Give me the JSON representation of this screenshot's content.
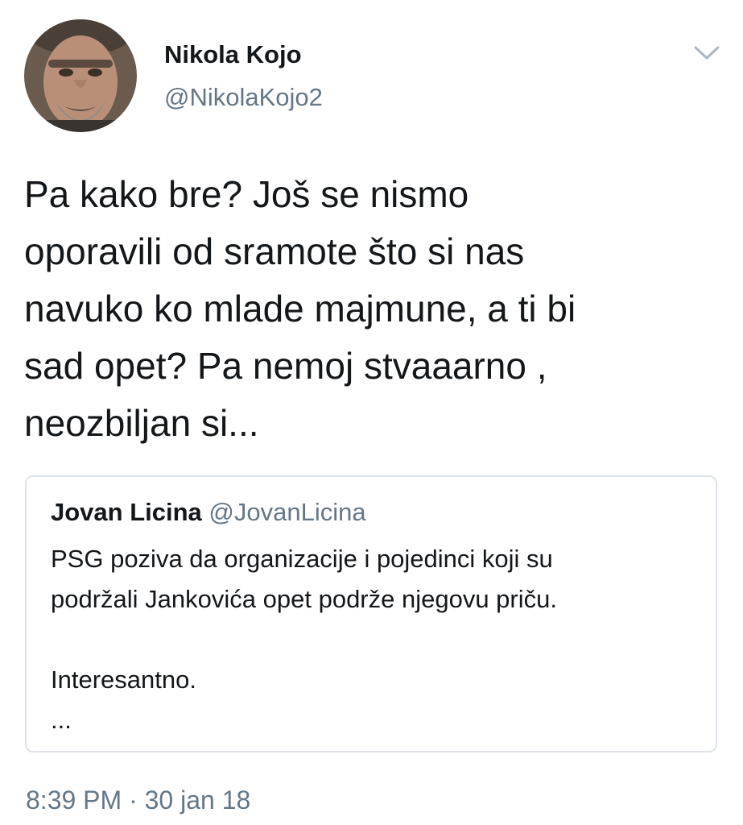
{
  "author": {
    "name": "Nikola Kojo",
    "handle": "@NikolaKojo2",
    "avatar_icon": "profile-photo"
  },
  "menu_icon": "chevron-down-icon",
  "tweet": {
    "lines": [
      "Pa kako bre? Još se nismo",
      "oporavili od sramote što si nas",
      "navuko ko mlade majmune, a ti bi",
      "sad opet? Pa nemoj stvaaarno ,",
      "neozbiljan si..."
    ]
  },
  "quoted_tweet": {
    "name": "Jovan Licina",
    "handle": "@JovanLicina",
    "lines": [
      "PSG poziva da organizacije i pojedinci koji su",
      "podržali Jankovića opet podrže njegovu priču.",
      "",
      "Interesantno.",
      "..."
    ]
  },
  "timestamp": "8:39 PM · 30 jan 18",
  "colors": {
    "text": "#14171a",
    "secondary": "#657786",
    "border": "#dde3e8"
  }
}
